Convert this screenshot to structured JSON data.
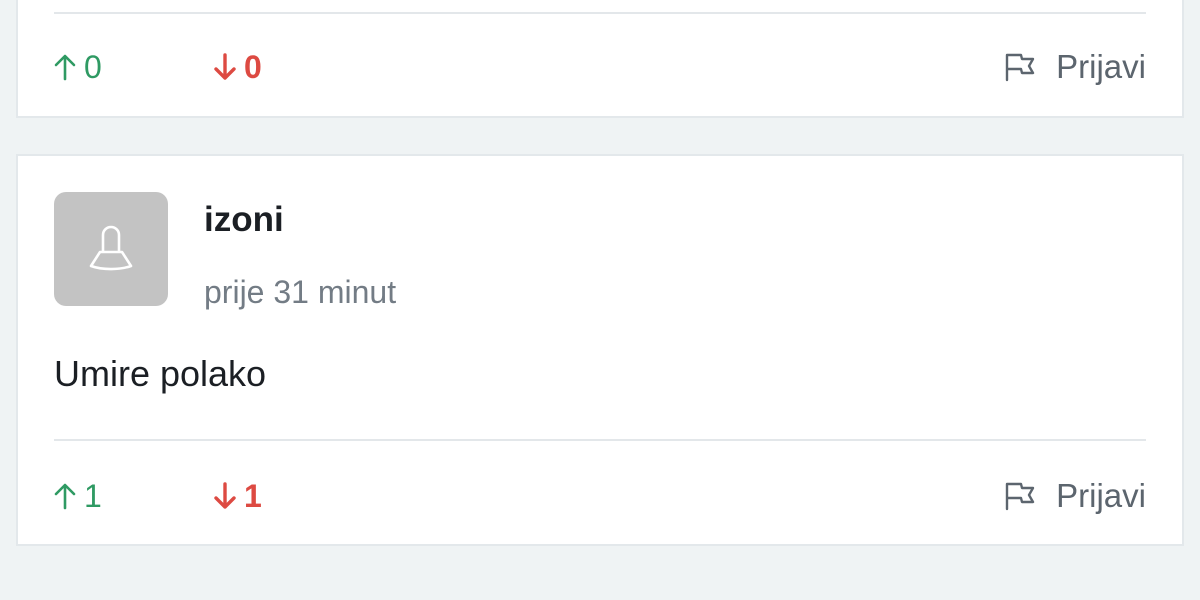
{
  "colors": {
    "page_background": "#eff3f4",
    "card_background": "#ffffff",
    "upvote": "#2f9a63",
    "downvote": "#dd4a42",
    "muted_text": "#737c85",
    "avatar_background": "#c3c3c3"
  },
  "comments": [
    {
      "upvotes": "0",
      "downvotes": "0",
      "report_label": "Prijavi",
      "icons": {
        "upvote": "arrow-up-icon",
        "downvote": "arrow-down-icon",
        "report": "flag-icon"
      }
    },
    {
      "author": "izoni",
      "timestamp": "prije 31 minut",
      "text": "Umire polako",
      "upvotes": "1",
      "downvotes": "1",
      "report_label": "Prijavi",
      "icons": {
        "avatar": "user-placeholder-icon",
        "upvote": "arrow-up-icon",
        "downvote": "arrow-down-icon",
        "report": "flag-icon"
      }
    }
  ]
}
